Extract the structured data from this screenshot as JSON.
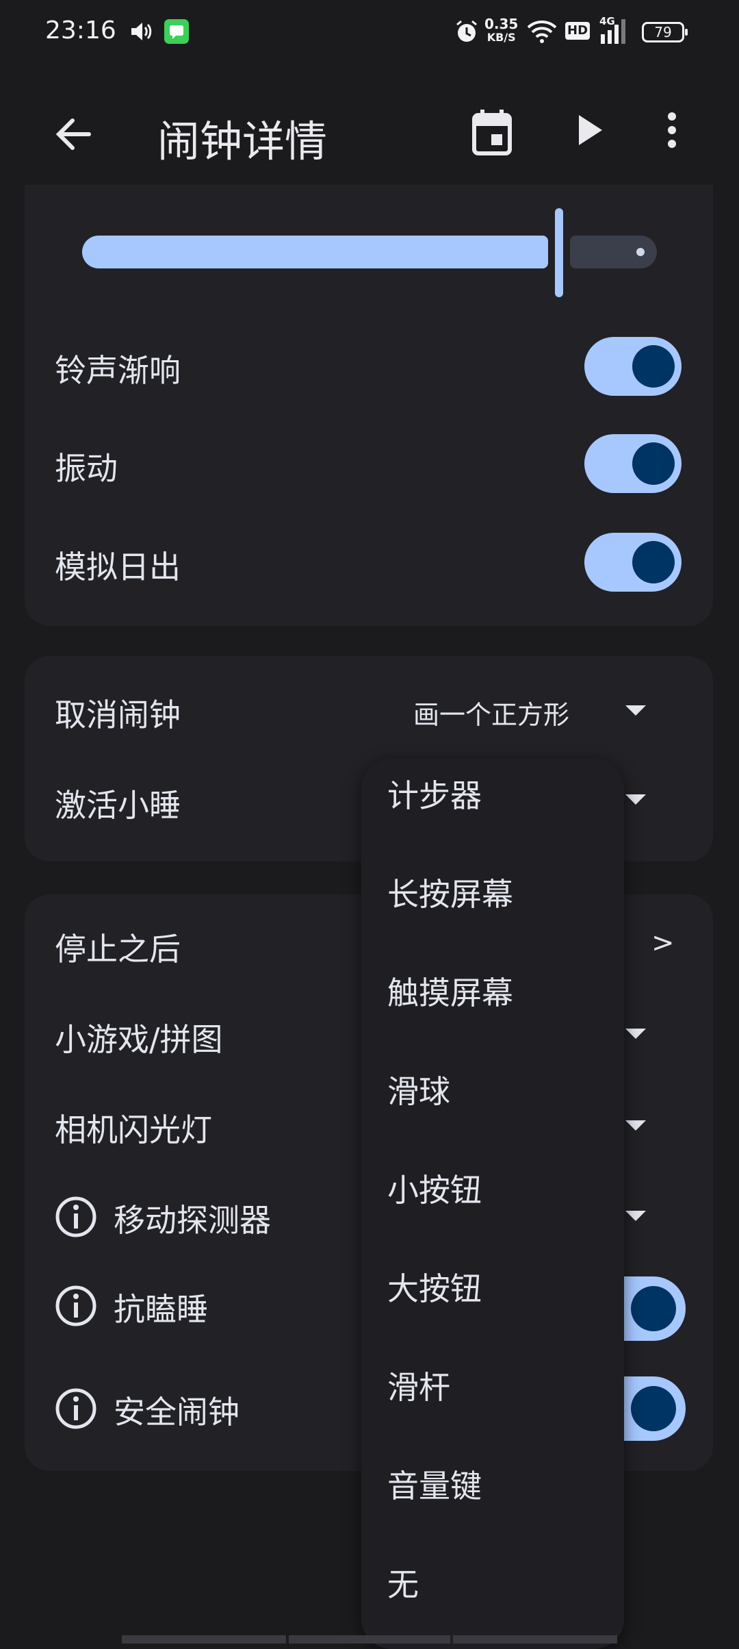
{
  "status_bar": {
    "time": "23:16",
    "net_speed_value": "0.35",
    "net_speed_unit": "KB/S",
    "hd": "HD",
    "network": "4G",
    "battery": "79"
  },
  "app_bar": {
    "title": "闹钟详情",
    "icons": [
      "back-arrow-icon",
      "calendar-icon",
      "play-icon",
      "more-vert-icon"
    ]
  },
  "volume_slider": {
    "level_fraction": 0.83
  },
  "settings": {
    "ringtone_fade": {
      "label": "铃声渐响",
      "on": true
    },
    "vibrate": {
      "label": "振动",
      "on": true
    },
    "sunrise": {
      "label": "模拟日出",
      "on": true
    },
    "dismiss": {
      "label": "取消闹钟",
      "value": "画一个正方形"
    },
    "snooze": {
      "label": "激活小睡"
    },
    "after_stop": {
      "label": "停止之后",
      "arrow": ">"
    },
    "puzzle": {
      "label": "小游戏/拼图"
    },
    "flash": {
      "label": "相机闪光灯"
    },
    "motion": {
      "label": "移动探测器"
    },
    "anti_sleep": {
      "label": "抗瞌睡"
    },
    "safe_alarm": {
      "label": "安全闹钟"
    }
  },
  "dropdown_menu": {
    "items": [
      "计步器",
      "长按屏幕",
      "触摸屏幕",
      "滑球",
      "小按钮",
      "大按钮",
      "滑杆",
      "音量键",
      "无"
    ]
  },
  "colors": {
    "background": "#1b1b1e",
    "card": "#212126",
    "accent": "#a6c8ff",
    "knob": "#003464",
    "menu": "#1f1e23"
  }
}
